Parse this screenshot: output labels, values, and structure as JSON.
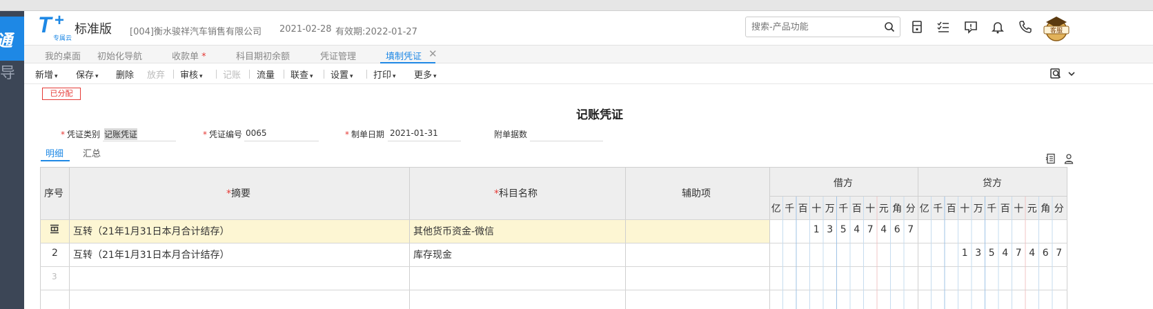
{
  "side_rail": {
    "tile_char": "通",
    "second_char": "导"
  },
  "header": {
    "edition": "标准版",
    "logo_sub": "专属云",
    "company": "[004]衡水骏祥汽车销售有限公司",
    "date": "2021-02-28",
    "validity": "有效期:2022-01-27",
    "search_placeholder": "搜索-产品功能",
    "avatar_label": "客服"
  },
  "tabs": [
    {
      "label": "我的桌面"
    },
    {
      "label": "初始化导航"
    },
    {
      "label": "收款单",
      "required_mark": "*"
    },
    {
      "label": "科目期初余额"
    },
    {
      "label": "凭证管理"
    },
    {
      "label": "填制凭证",
      "close": "✕"
    }
  ],
  "toolbar": {
    "new": "新增",
    "save": "保存",
    "delete": "删除",
    "discard": "放弃",
    "review": "审核",
    "post": "记账",
    "flow": "流量",
    "link": "联查",
    "settings": "设置",
    "print": "打印",
    "more": "更多"
  },
  "status_badge": "已分配",
  "voucher": {
    "title": "记账凭证",
    "type_label": "凭证类别",
    "type_value": "记账凭证",
    "number_label": "凭证编号",
    "number_value": "0065",
    "date_label": "制单日期",
    "date_value": "2021-01-31",
    "attach_label": "附单据数",
    "attach_value": "",
    "required_mark": "*"
  },
  "subtabs": {
    "detail": "明细",
    "summary": "汇总"
  },
  "grid": {
    "headers": {
      "seq": "序号",
      "summary": "摘要",
      "account": "科目名称",
      "aux": "辅助项",
      "debit": "借方",
      "credit": "贷方",
      "required_mark": "*"
    },
    "digit_units": [
      "亿",
      "千",
      "百",
      "十",
      "万",
      "千",
      "百",
      "十",
      "元",
      "角",
      "分"
    ],
    "rows": [
      {
        "seq": "",
        "summary": "互转（21年1月31日本月合计结存）",
        "account": "其他货币资金-微信",
        "aux": "",
        "debit": "135474.67",
        "credit": "",
        "debit_digits": "13547467",
        "credit_digits": ""
      },
      {
        "seq": "2",
        "summary": "互转（21年1月31日本月合计结存）",
        "account": "库存现金",
        "aux": "",
        "debit": "",
        "credit": "135474.67",
        "debit_digits": "",
        "credit_digits": "13547467"
      },
      {
        "seq": "3",
        "summary": "",
        "account": "",
        "aux": "",
        "debit": "",
        "credit": "",
        "debit_digits": "",
        "credit_digits": ""
      }
    ]
  },
  "colors": {
    "accent": "#1e88e5",
    "required": "#e53935",
    "selected_row": "#fdf6d3",
    "header_bg": "#eeeeee",
    "rail": "#3c4656",
    "digit_line_blue": "#c6dcef",
    "digit_line_red": "#f0c4c4"
  },
  "icons": {
    "search": "search-icon",
    "calculator": "calculator-icon",
    "tasks": "task-check-icon",
    "message": "message-icon",
    "bell": "bell-icon",
    "phone": "phone-icon",
    "locate": "locate-icon",
    "row_insert": "row-insert-icon",
    "printer_settings": "person-setting-icon"
  }
}
